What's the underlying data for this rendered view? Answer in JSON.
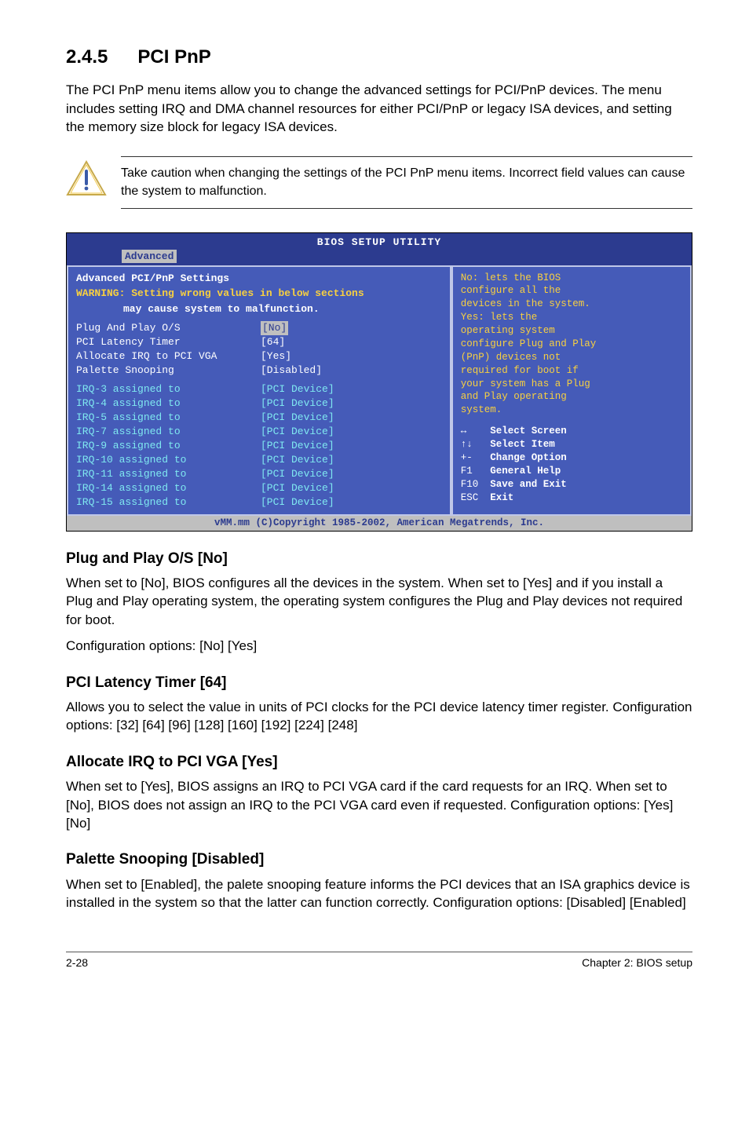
{
  "section": {
    "number": "2.4.5",
    "title": "PCI PnP"
  },
  "intro": "The PCI PnP menu items allow you to change the advanced settings for PCI/PnP devices. The menu includes setting IRQ and DMA channel resources for either PCI/PnP or legacy ISA devices, and setting the memory size block for legacy ISA devices.",
  "note": "Take caution when changing the settings of the PCI PnP menu items. Incorrect field values can cause the system to malfunction.",
  "bios": {
    "title": "BIOS SETUP UTILITY",
    "tab": "Advanced",
    "left": {
      "heading": "Advanced PCI/PnP Settings",
      "warn1": "WARNING: Setting wrong values in below sections",
      "warn2": "may cause system to malfunction.",
      "rows_top": [
        {
          "label": "Plug And Play O/S",
          "value": "[No]",
          "highlight": true
        },
        {
          "label": "PCI Latency Timer",
          "value": "[64]"
        },
        {
          "label": "Allocate IRQ to PCI VGA",
          "value": "[Yes]"
        },
        {
          "label": "Palette Snooping",
          "value": "[Disabled]"
        }
      ],
      "rows_irq": [
        {
          "label": "IRQ-3 assigned to",
          "value": "[PCI Device]"
        },
        {
          "label": "IRQ-4 assigned to",
          "value": "[PCI Device]"
        },
        {
          "label": "IRQ-5 assigned to",
          "value": "[PCI Device]"
        },
        {
          "label": "IRQ-7 assigned to",
          "value": "[PCI Device]"
        },
        {
          "label": "IRQ-9 assigned to",
          "value": "[PCI Device]"
        },
        {
          "label": "IRQ-10 assigned to",
          "value": "[PCI Device]"
        },
        {
          "label": "IRQ-11 assigned to",
          "value": "[PCI Device]"
        },
        {
          "label": "IRQ-14 assigned to",
          "value": "[PCI Device]"
        },
        {
          "label": "IRQ-15 assigned to",
          "value": "[PCI Device]"
        }
      ]
    },
    "right": {
      "help_lines": [
        {
          "text": "No: lets the BIOS",
          "cls": "bios-help-yellow"
        },
        {
          "text": "configure all the",
          "cls": "bios-help-yellow"
        },
        {
          "text": "devices in the system.",
          "cls": "bios-help-yellow"
        },
        {
          "text": "Yes: lets the",
          "cls": "bios-help-yellow"
        },
        {
          "text": "operating system",
          "cls": "bios-help-yellow"
        },
        {
          "text": "configure Plug and Play",
          "cls": "bios-help-yellow"
        },
        {
          "text": "(PnP) devices not",
          "cls": "bios-help-yellow"
        },
        {
          "text": "required for boot if",
          "cls": "bios-help-yellow"
        },
        {
          "text": "your system has a Plug",
          "cls": "bios-help-yellow"
        },
        {
          "text": "and Play operating",
          "cls": "bios-help-yellow"
        },
        {
          "text": "system.",
          "cls": "bios-help-yellow"
        }
      ],
      "keys": [
        {
          "k": "↔",
          "d": "Select Screen"
        },
        {
          "k": "↑↓",
          "d": "Select Item"
        },
        {
          "k": "+-",
          "d": "Change Option"
        },
        {
          "k": "F1",
          "d": "General Help"
        },
        {
          "k": "F10",
          "d": "Save and Exit"
        },
        {
          "k": "ESC",
          "d": "Exit"
        }
      ]
    },
    "footer": "vMM.mm (C)Copyright 1985-2002, American Megatrends, Inc."
  },
  "subs": [
    {
      "h": "Plug and Play O/S [No]",
      "p": "When set to [No], BIOS configures all the devices in the system. When set to [Yes] and if you install a Plug and Play operating system, the operating system configures the Plug and Play devices not required for boot.",
      "p2": "Configuration options: [No] [Yes]"
    },
    {
      "h": "PCI Latency Timer [64]",
      "p": "Allows you to select the value in units of PCI clocks for the PCI device latency timer register. Configuration options: [32] [64] [96] [128] [160] [192] [224] [248]"
    },
    {
      "h": "Allocate IRQ to PCI VGA [Yes]",
      "p": "When set to [Yes], BIOS assigns an IRQ to PCI VGA card if the card requests for an IRQ. When set to [No], BIOS does not assign an IRQ to the PCI VGA card even if requested. Configuration options: [Yes] [No]"
    },
    {
      "h": "Palette Snooping [Disabled]",
      "p": "When set to [Enabled], the palete snooping feature informs the PCI devices that an ISA graphics device is installed in the system so that the latter can function correctly. Configuration options: [Disabled] [Enabled]"
    }
  ],
  "footer": {
    "left": "2-28",
    "right": "Chapter 2: BIOS setup"
  }
}
